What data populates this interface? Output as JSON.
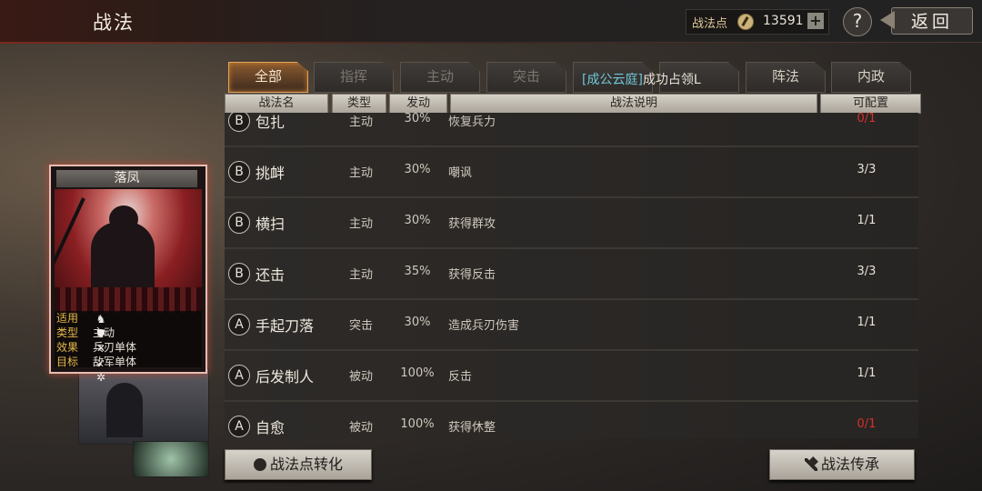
{
  "header": {
    "title": "战法",
    "points_label": "战法点",
    "points_icon": "compass-icon",
    "points_value": "13591",
    "plus_label": "+",
    "help_label": "?",
    "back_label": "返回"
  },
  "card": {
    "name": "落凤",
    "rows": [
      {
        "key": "适用",
        "val": ""
      },
      {
        "key": "类型",
        "val": "主动"
      },
      {
        "key": "效果",
        "val": "兵刃单体"
      },
      {
        "key": "目标",
        "val": "敌军单体"
      }
    ],
    "troop_icons": [
      "cavalry-icon",
      "shield-icon",
      "bow-icon",
      "spear-icon",
      "wheel-icon"
    ]
  },
  "tabs": [
    {
      "label": "全部",
      "active": true
    },
    {
      "label": "指挥",
      "active": false
    },
    {
      "label": "主动",
      "active": false
    },
    {
      "label": "突击",
      "active": false
    },
    {
      "label": "",
      "active": false
    },
    {
      "label": "",
      "active": false
    },
    {
      "label": "阵法",
      "active": false
    },
    {
      "label": "内政",
      "active": false
    }
  ],
  "toast": {
    "name": "[成公云庭]",
    "text": "成功占领L"
  },
  "table": {
    "headers": [
      "战法名",
      "类型",
      "发动",
      "战法说明",
      "可配置"
    ],
    "rows": [
      {
        "grade": "B",
        "name": "包扎",
        "type": "主动",
        "pct": "30%",
        "desc": "恢复兵力",
        "count": "0/1",
        "red": true
      },
      {
        "grade": "B",
        "name": "挑衅",
        "type": "主动",
        "pct": "30%",
        "desc": "嘲讽",
        "count": "3/3",
        "red": false
      },
      {
        "grade": "B",
        "name": "横扫",
        "type": "主动",
        "pct": "30%",
        "desc": "获得群攻",
        "count": "1/1",
        "red": false
      },
      {
        "grade": "B",
        "name": "还击",
        "type": "主动",
        "pct": "35%",
        "desc": "获得反击",
        "count": "3/3",
        "red": false
      },
      {
        "grade": "A",
        "name": "手起刀落",
        "type": "突击",
        "pct": "30%",
        "desc": "造成兵刃伤害",
        "count": "1/1",
        "red": false
      },
      {
        "grade": "A",
        "name": "后发制人",
        "type": "被动",
        "pct": "100%",
        "desc": "反击",
        "count": "1/1",
        "red": false
      },
      {
        "grade": "A",
        "name": "自愈",
        "type": "被动",
        "pct": "100%",
        "desc": "获得休整",
        "count": "0/1",
        "red": true
      }
    ]
  },
  "footer": {
    "convert_label": "战法点转化",
    "inherit_label": "战法传承"
  }
}
